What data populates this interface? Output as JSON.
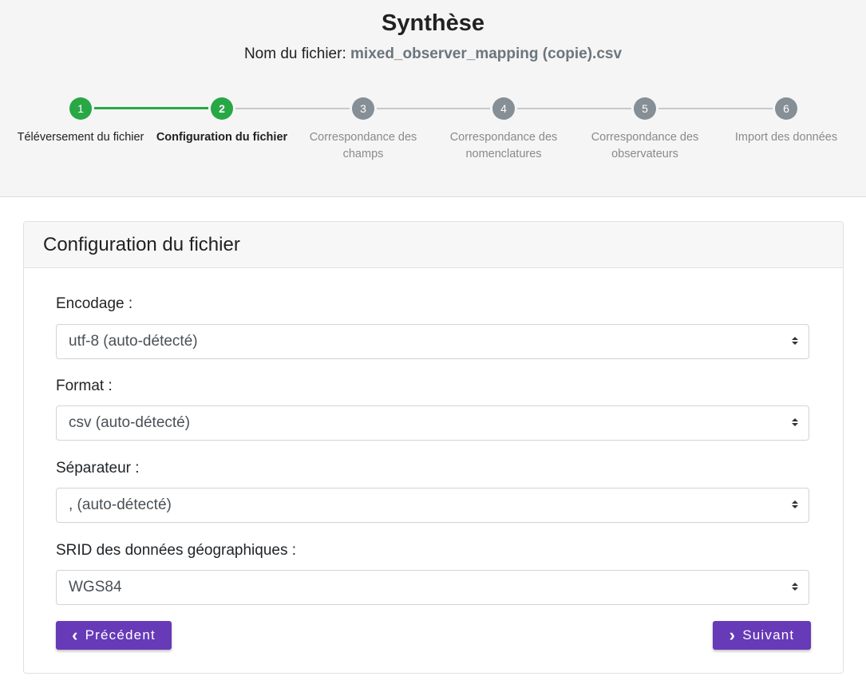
{
  "header": {
    "title": "Synthèse",
    "file_prefix": "Nom du fichier:",
    "file_name": "mixed_observer_mapping (copie).csv"
  },
  "stepper": {
    "steps": [
      {
        "number": "1",
        "label": "Téléversement du fichier",
        "state": "done"
      },
      {
        "number": "2",
        "label": "Configuration du fichier",
        "state": "active"
      },
      {
        "number": "3",
        "label": "Correspondance des champs",
        "state": "pending"
      },
      {
        "number": "4",
        "label": "Correspondance des nomenclatures",
        "state": "pending"
      },
      {
        "number": "5",
        "label": "Correspondance des observateurs",
        "state": "pending"
      },
      {
        "number": "6",
        "label": "Import des données",
        "state": "pending"
      }
    ]
  },
  "card": {
    "title": "Configuration du fichier",
    "fields": {
      "encoding": {
        "label": "Encodage :",
        "value": "utf-8 (auto-détecté)"
      },
      "format": {
        "label": "Format :",
        "value": "csv (auto-détecté)"
      },
      "separator": {
        "label": "Séparateur :",
        "value": ", (auto-détecté)"
      },
      "srid": {
        "label": "SRID des données géographiques :",
        "value": "WGS84"
      }
    },
    "buttons": {
      "previous": {
        "label": "Précédent",
        "icon": "chevron-left-icon"
      },
      "next": {
        "label": "Suivant",
        "icon": "chevron-right-icon"
      }
    }
  },
  "colors": {
    "accent": "#673ab7",
    "success": "#28a745",
    "pending": "#868e96"
  }
}
